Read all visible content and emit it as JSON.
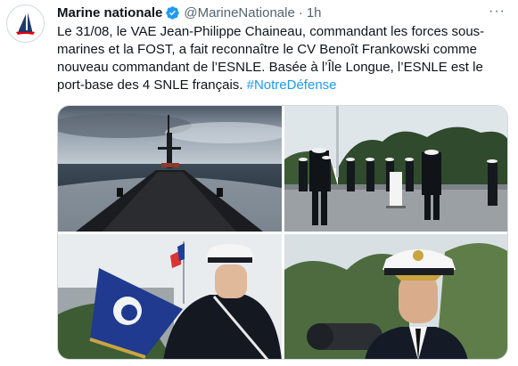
{
  "tweet": {
    "display_name": "Marine nationale",
    "handle": "@MarineNationale",
    "separator": "·",
    "time": "1h",
    "more_label": "···",
    "text_main": "Le 31/08, le VAE Jean-Philippe Chaineau, commandant les forces sous-marines et la FOST, a fait reconnaître le CV Benoît Frankowski comme nouveau commandant de l’ESNLE. Basée à l’Île Longue, l’ESNLE est le port-base des 4 SNLE français. ",
    "hashtag": "#NotreDéfense"
  },
  "colors": {
    "accent": "#1d9bf0",
    "secondary_text": "#536471",
    "border": "#cfd9de"
  },
  "icons": {
    "avatar": "marine-nationale-logo",
    "verified": "verified-badge-icon",
    "more": "more-options-icon"
  },
  "media": {
    "count": 4
  }
}
